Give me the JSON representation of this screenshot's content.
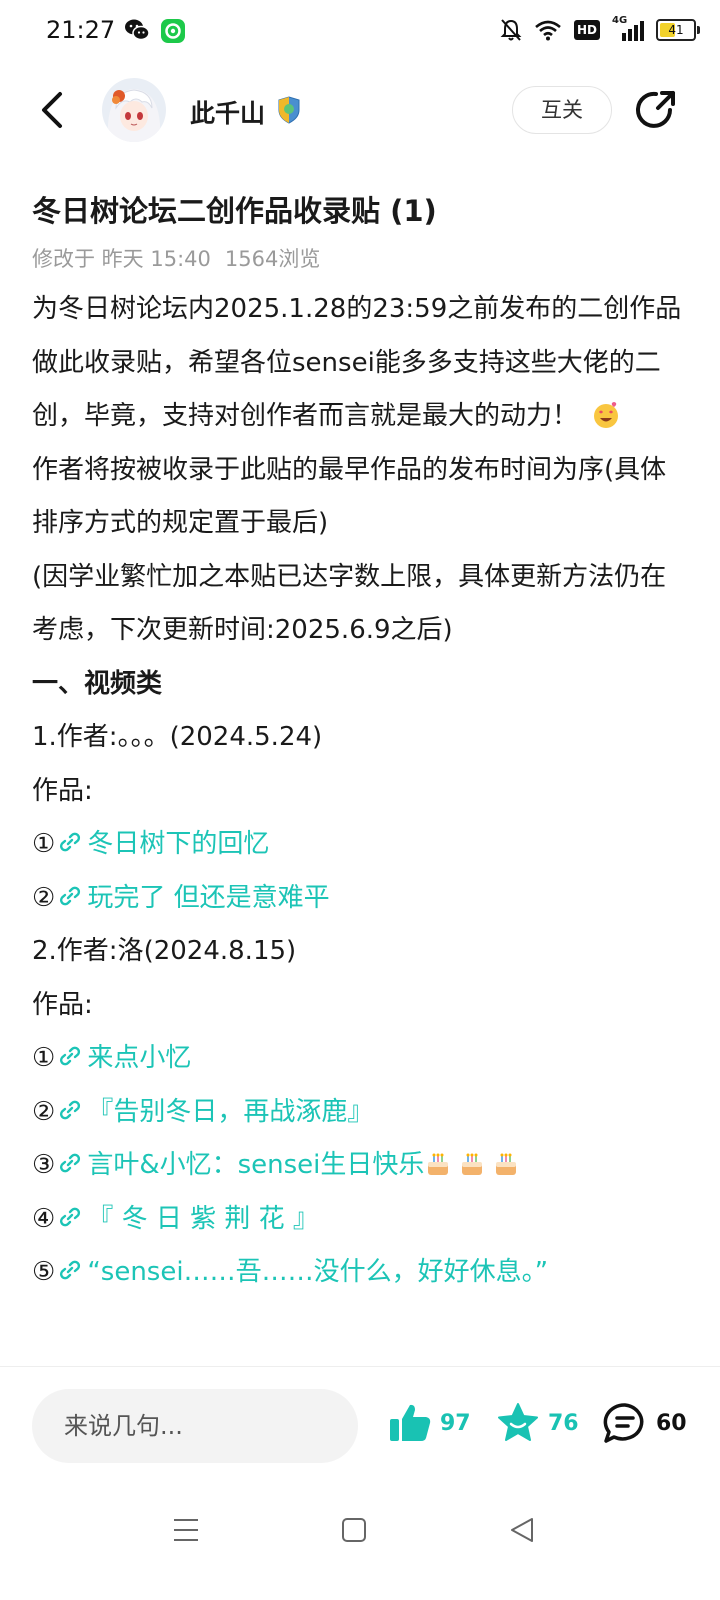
{
  "status_bar": {
    "time": "21:27",
    "left_icons": [
      "wechat-icon",
      "app-notification-icon"
    ],
    "right_icons": [
      "silent-bell-icon",
      "wifi-icon",
      "hd-icon",
      "4g-signal-icon",
      "battery-icon"
    ],
    "hd_label": "HD",
    "network_label": "4G",
    "battery_level": "41",
    "battery_color": "#f2d22b"
  },
  "header": {
    "username": "此千山",
    "follow_label": "互关",
    "icons": [
      "back-arrow-icon",
      "level-badge-icon",
      "share-icon"
    ]
  },
  "post": {
    "title": "冬日树论坛二创作品收录贴 (1)",
    "modified": "修改于 昨天 15:40",
    "views": "1564浏览",
    "intro": "为冬日树论坛内2025.1.28的23:59之前发布的二创作品做此收录贴，希望各位sensei能多多支持这些大佬的二创，毕竟，支持对创作者而言就是最大的动力！",
    "order_note": "作者将按被收录于此贴的最早作品的发布时间为序(具体排序方式的规定置于最后)",
    "update_note": "(因学业繁忙加之本贴已达字数上限，具体更新方法仍在考虑，下次更新时间:2025.6.9之后)",
    "section_title": "一、视频类",
    "authors": [
      {
        "heading": "1.作者:。。。(2024.5.24)",
        "works_label": "作品:",
        "works": [
          {
            "num": "①",
            "title": "冬日树下的回忆"
          },
          {
            "num": "②",
            "title": "玩完了 但还是意难平"
          }
        ]
      },
      {
        "heading": "2.作者:洛(2024.8.15)",
        "works_label": "作品:",
        "works": [
          {
            "num": "①",
            "title": "来点小忆"
          },
          {
            "num": "②",
            "title": "『告别冬日，再战涿鹿』"
          },
          {
            "num": "③",
            "title": "言叶&小忆：sensei生日快乐"
          },
          {
            "num": "④",
            "title": "『 冬 日 紫 荆 花 』"
          },
          {
            "num": "⑤",
            "title": "“sensei……吾……没什么，好好休息。”"
          }
        ]
      }
    ],
    "accent_color": "#1cc4b6"
  },
  "bottom_bar": {
    "comment_placeholder": "来说几句...",
    "likes": "97",
    "favorites": "76",
    "comments": "60"
  },
  "nav_bar": {
    "icons": [
      "menu-icon",
      "home-square-icon",
      "back-triangle-icon"
    ]
  }
}
